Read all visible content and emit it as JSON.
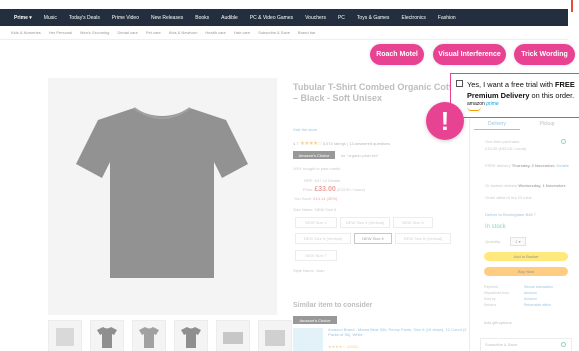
{
  "nav": {
    "items": [
      "Prime ▾",
      "Music",
      "Today's Deals",
      "Prime Video",
      "New Releases",
      "Books",
      "Audible",
      "PC & Video Games",
      "Vouchers",
      "PC",
      "Toys & Games",
      "Electronics",
      "Fashion"
    ]
  },
  "subnav": {
    "items": [
      "Kids & Nurseries",
      "Her Personal",
      "Men's Grooming",
      "Dental care",
      "Pet care",
      "Kids & Newborn",
      "Health care",
      "Hair care",
      "Subscribe & Save",
      "Brand bar"
    ]
  },
  "pills": [
    "Roach Motel",
    "Visual Interference",
    "Trick Wording"
  ],
  "product": {
    "title": "Tubular T-Shirt Combed Organic Cotton – Black - Soft Unisex",
    "store": "Visit the store",
    "rating": "4.7",
    "stars": "★★★★☆",
    "rating_count": "5,074 ratings",
    "answered": "13 answered questions",
    "badge": "Amazon's Choice",
    "badge_for": "for \"organic plain tee\"",
    "bought": "100+ bought in past month",
    "rrp_label": "RRP:",
    "rrp_value": "£47.14 Details",
    "price_label": "Price:",
    "price_value": "£33.00",
    "price_unit": "(£33.00 / count)",
    "save_label": "You Save:",
    "save_value": "£14.14 (30%)",
    "size_label": "Size Name:",
    "size_value": "NEW Size 6",
    "sizes": [
      "NEW Size 4",
      "NEW Size 4 (Vertical)",
      "NEW Size 5",
      "NEW Size 5 (Vertical)",
      "NEW Size 6",
      "NEW Size 6 (Vertical)",
      "NEW Size 7"
    ],
    "style_label": "Style Name:",
    "style_value": "Joan"
  },
  "similar": {
    "heading": "Similar item to consider",
    "badge": "Amazon's Choice",
    "text": "Amazon Brand - Mama Bear Silk, Peony Pants, Size 6 (16 strips), 12 Count (2 Packs of 36), White",
    "stars": "★★★★☆ (8552)"
  },
  "right": {
    "tab_delivery": "Delivery",
    "tab_pickup": "Pickup",
    "one_time": "One-time purchase:",
    "one_time_price": "£33.00 (£33.00 / count)",
    "free_delivery": "FREE delivery",
    "free_delivery_date": "Thursday, 2 November.",
    "details": "Details",
    "fastest": "Or fastest delivery",
    "fastest_date": "Wednesday, 1 November.",
    "order_within": "Order within 6 hrs 23 mins.",
    "deliver_to": "Deliver to Birmingham B48 7",
    "in_stock": "In stock",
    "quantity_label": "Quantity:",
    "quantity_value": "1 ▾",
    "add_to_basket": "Add to Basket",
    "buy_now": "Buy Now",
    "dispatch_rows": [
      {
        "k": "Payment",
        "v": "Secure transaction"
      },
      {
        "k": "Dispatches from",
        "v": "Amazon"
      },
      {
        "k": "Sold by",
        "v": "Amazon"
      },
      {
        "k": "Returns",
        "v": "Returnable within"
      }
    ],
    "gift": "Add gift options",
    "subscribe": "Subscribe & Save:"
  },
  "callout": {
    "text_plain": "Yes, I want a free trial with ",
    "text_bold": "FREE Premium Delivery",
    "text_tail": " on this order.",
    "amazon": "amazon",
    "prime": "prime"
  },
  "alert_glyph": "!",
  "colors": {
    "accent": "#e84393",
    "nav_bg": "#232f3e",
    "link": "#4a90c7",
    "price": "#d9534f"
  }
}
